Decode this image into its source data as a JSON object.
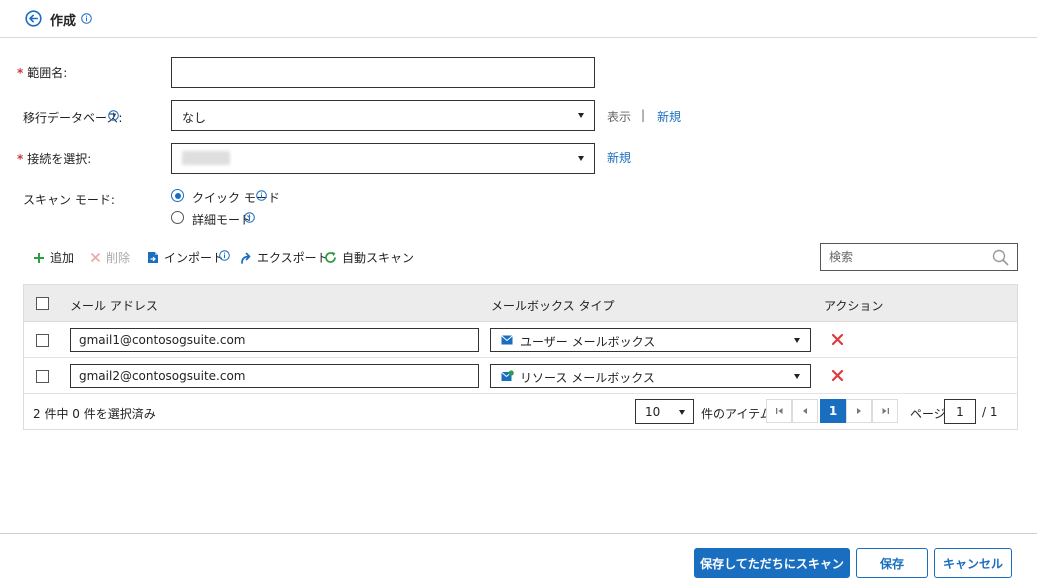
{
  "header": {
    "title": "作成"
  },
  "form": {
    "scope_name": {
      "label": "範囲名:",
      "value": ""
    },
    "migration_db": {
      "label": "移行データベース:",
      "value": "なし",
      "link_view": "表示",
      "separator": "|",
      "link_new": "新規"
    },
    "connection": {
      "label": "接続を選択:",
      "link_new": "新規"
    },
    "scan_mode": {
      "label": "スキャン モード:",
      "quick": "クイック モード",
      "detail": "詳細モード",
      "selected": "quick"
    }
  },
  "toolbar": {
    "add": "追加",
    "delete": "削除",
    "import": "インポート",
    "export": "エクスポート",
    "auto_scan": "自動スキャン",
    "search_placeholder": "検索"
  },
  "table": {
    "columns": {
      "email": "メール アドレス",
      "mailbox_type": "メールボックス タイプ",
      "action": "アクション"
    },
    "rows": [
      {
        "email": "gmail1@contosogsuite.com",
        "mailbox_type": "ユーザー メールボックス",
        "type_icon": "mail-icon"
      },
      {
        "email": "gmail2@contosogsuite.com",
        "mailbox_type": "リソース メールボックス",
        "type_icon": "resource-mailbox-icon"
      }
    ]
  },
  "footer_bar": {
    "selection": "2 件中 0 件を選択済み",
    "page_size": "10",
    "items_label": "件のアイテム",
    "current_page": "1",
    "page_label": "ページ",
    "page_input": "1",
    "total_pages": "/ 1"
  },
  "actions": {
    "save_scan": "保存してただちにスキャン",
    "save": "保存",
    "cancel": "キャンセル"
  },
  "colors": {
    "accent": "#1a6ec0",
    "required": "#d13438",
    "add": "#2e9e45",
    "delete_icon": "#e03b3b"
  }
}
